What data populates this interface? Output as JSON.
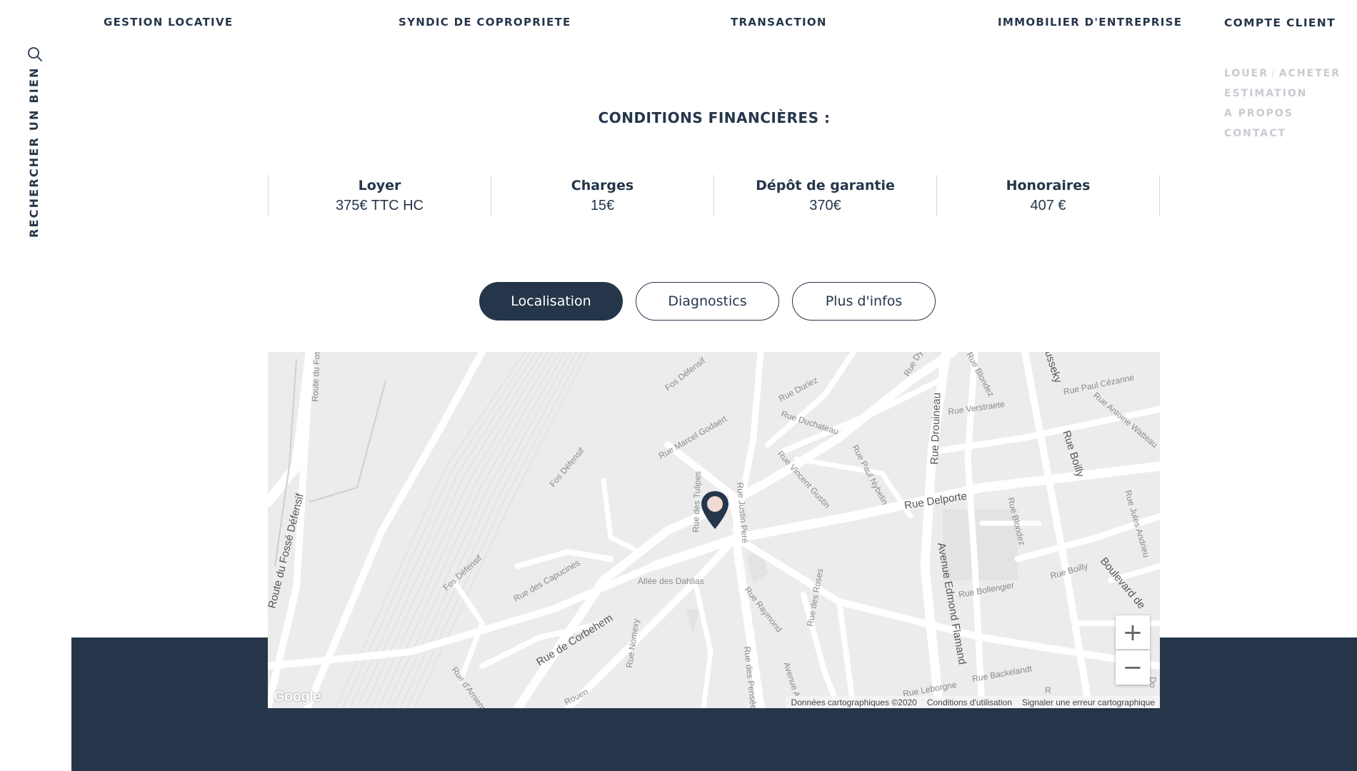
{
  "nav": {
    "gestion": "GESTION LOCATIVE",
    "syndic": "SYNDIC DE COPROPRIETE",
    "transaction": "TRANSACTION",
    "immobilier": "IMMOBILIER D'ENTREPRISE",
    "compte": "COMPTE CLIENT"
  },
  "subnav": {
    "louer": "LOUER",
    "separator": "/",
    "acheter": "ACHETER",
    "estimation": "ESTIMATION",
    "apropos": "A PROPOS",
    "contact": "CONTACT"
  },
  "sidebar": {
    "search_label": "RECHERCHER UN BIEN",
    "search_icon": "search-icon"
  },
  "conditions": {
    "title": "CONDITIONS FINANCIÈRES :",
    "items": [
      {
        "label": "Loyer",
        "value": "375€ TTC HC"
      },
      {
        "label": "Charges",
        "value": "15€"
      },
      {
        "label": "Dépôt de garantie",
        "value": "370€"
      },
      {
        "label": "Honoraires",
        "value": "407 €"
      }
    ]
  },
  "tabs": [
    {
      "label": "Localisation",
      "active": true
    },
    {
      "label": "Diagnostics",
      "active": false
    },
    {
      "label": "Plus d'infos",
      "active": false
    }
  ],
  "map": {
    "streets": [
      "Route du Fos",
      "Route du Fossé Défensif",
      "Fos Défensif",
      "Fos Défensif",
      "Fos Défensif",
      "Rue Marcel Godaert",
      "Rue Duriez",
      "Rue Duchateau",
      "Rue Vincent Gustin",
      "Rue Paul Nybelin",
      "Rue Drouineau",
      "Rue Verstraete",
      "Rue Blondez",
      "Rue Dy",
      "usseky",
      "Rue Paul Cézanne",
      "Rue Antoine Watteau",
      "Rue Boilly",
      "Rue Delporte",
      "Rue des Tulipes",
      "Rue Justin Peré",
      "Rue des Capucines",
      "Allée des Dahlias",
      "Rue de Corbehem",
      "Rue Nomexy",
      "Rue Raymond",
      "Rue des Roses",
      "Avenue Edmond Flamand",
      "Rue Bollengier",
      "Rue Blondez",
      "Rue Jules Andrieu",
      "Rue Boilly",
      "Boulevard de",
      "Rue d'Amiens",
      "Rouen",
      "Rue des Pensée",
      "Avenue A",
      "Rue Leborgne",
      "Rue Backelandt",
      "R",
      "Do"
    ],
    "google": "Google",
    "attribution": {
      "data": "Données cartographiques ©2020",
      "terms": "Conditions d'utilisation",
      "report": "Signaler une erreur cartographique"
    },
    "zoom_in": "+",
    "zoom_out": "−",
    "marker_icon": "map-pin-icon",
    "colors": {
      "marker": "#25364a",
      "marker_dot": "#f2d9d3",
      "land": "#ececec",
      "road": "#ffffff"
    }
  },
  "colors": {
    "primary": "#25364a",
    "muted": "#c7cbd1",
    "border": "#d3d6da"
  }
}
